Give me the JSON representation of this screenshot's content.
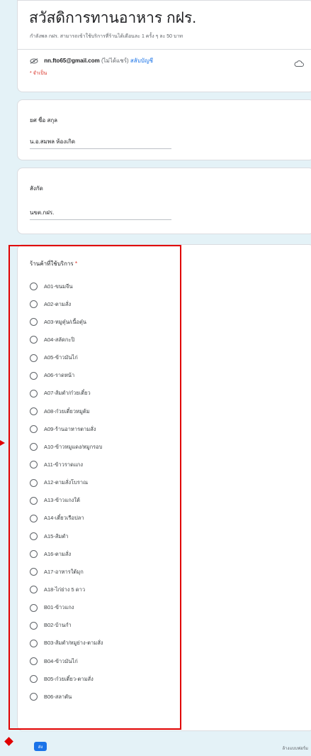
{
  "form": {
    "title": "สวัสดิการทานอาหาร กฝร.",
    "description": "กำลังพล กฝร. สามารถเข้าใช้บริการที่ร้านได้เดือนละ 1 ครั้ง ๆ ละ 50 บาท",
    "account_email": "nn.fto65@gmail.com",
    "account_shared": "(ไม่ได้แชร์)",
    "switch_account": "สลับบัญชี",
    "required_note": "* จำเป็น"
  },
  "questions": {
    "name": {
      "label": "ยศ ชื่อ สกุล",
      "answer": "น.อ.สมพล ห้องเกิด"
    },
    "unit": {
      "label": "สังกัด",
      "answer": "นขต.กฝร."
    },
    "shop": {
      "label": "ร้านค้าที่ใช้บริการ",
      "required_mark": "*",
      "options": [
        "A01-ขนมจีน",
        "A02-ตามสั่ง",
        "A03-หมูตุ๋น/เนื้อตุ๋น",
        "A04-สลัดกะปิ",
        "A05-ข้าวมันไก่",
        "A06-ราดหน้า",
        "A07-ส้มตำ/ก๋วยเตี๋ยว",
        "A08-ก๋วยเตี๋ยวหมูต้ม",
        "A09-ร้านอาหารตามสั่ง",
        "A10-ข้าวหมูแดง/หมูกรอบ",
        "A11-ข้าวราดแกง",
        "A12-ตามสั่งโบราณ",
        "A13-ข้าวแกงใต้",
        "A14-เตี๋ยวเรือปลา",
        "A15-ส้มตำ",
        "A16-ตามสั่ง",
        "A17-อาหารใต้มุก",
        "A18-ไก่ย่าง 5 ดาว",
        "B01-ข้าวแกง",
        "B02-บ้านกำ",
        "B03-ส้มตำ/หมูย่าง-ตามสั่ง",
        "B04-ข้าวมันไก่",
        "B05-ก๋วยเตี๋ยว-ตามสั่ง",
        "B06-สลาตัน"
      ]
    }
  },
  "submit_label": "ส่ง",
  "footer_note": "ล้างแบบฟอร์ม",
  "colors": {
    "background": "#e4f2f7",
    "accent": "#1a73e8",
    "highlight": "#e00000",
    "required": "#d93025"
  }
}
